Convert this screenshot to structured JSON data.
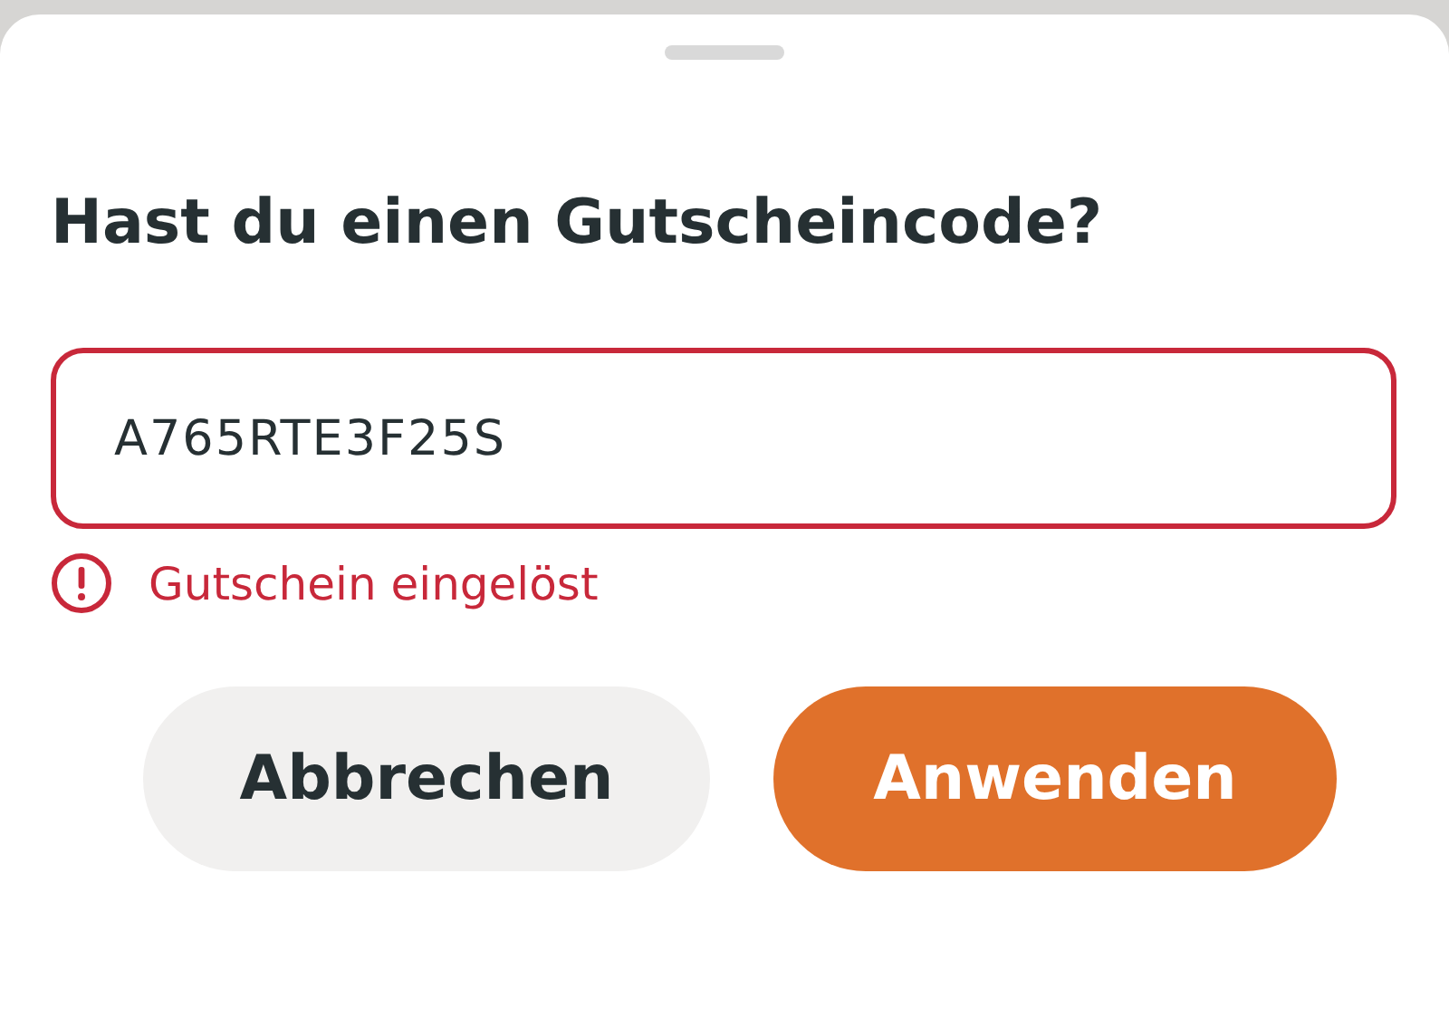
{
  "sheet": {
    "title": "Hast du einen Gutscheincode?"
  },
  "voucher_field": {
    "value": "A765RTE3F25S",
    "error": true
  },
  "error_message": "Gutschein eingelöst",
  "buttons": [
    {
      "label": "Abbrechen",
      "kind": "secondary"
    },
    {
      "label": "Anwenden",
      "kind": "primary"
    }
  ]
}
